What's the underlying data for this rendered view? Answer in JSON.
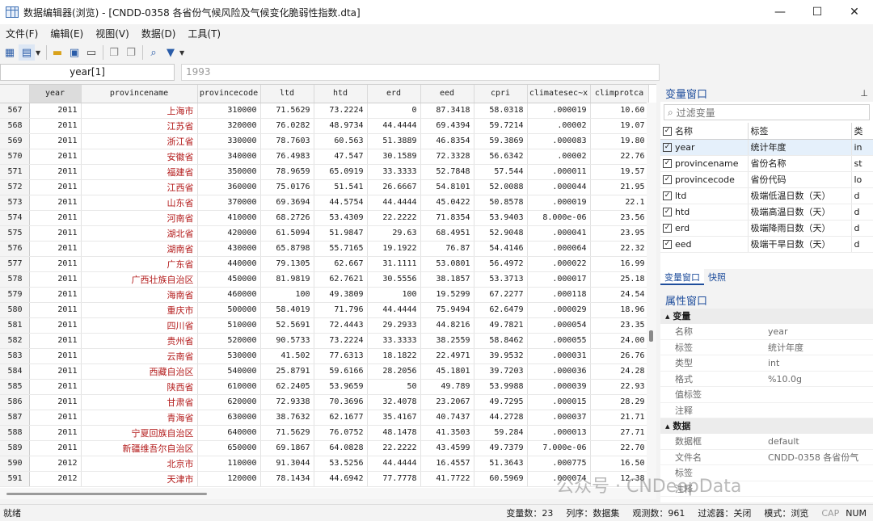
{
  "window": {
    "title": "数据编辑器(浏览) - [CNDD-0358 各省份气候风险及气候变化脆弱性指数.dta]",
    "controls": [
      "—",
      "☐",
      "✕"
    ]
  },
  "menu": [
    "文件(F)",
    "编辑(E)",
    "视图(V)",
    "数据(D)",
    "工具(T)"
  ],
  "cmd": {
    "varname": "year[1]",
    "value": "1993"
  },
  "columns": [
    "year",
    "provincename",
    "provincecode",
    "ltd",
    "htd",
    "erd",
    "eed",
    "cpri",
    "climatesec~x",
    "climprotca"
  ],
  "rows": [
    [
      "567",
      "2011",
      "上海市",
      "310000",
      "71.5629",
      "73.2224",
      "0",
      "87.3418",
      "58.0318",
      ".000019",
      "10.60"
    ],
    [
      "568",
      "2011",
      "江苏省",
      "320000",
      "76.0282",
      "48.9734",
      "44.4444",
      "69.4394",
      "59.7214",
      ".00002",
      "19.07"
    ],
    [
      "569",
      "2011",
      "浙江省",
      "330000",
      "78.7603",
      "60.563",
      "51.3889",
      "46.8354",
      "59.3869",
      ".000083",
      "19.80"
    ],
    [
      "570",
      "2011",
      "安徽省",
      "340000",
      "76.4983",
      "47.547",
      "30.1589",
      "72.3328",
      "56.6342",
      ".00002",
      "22.76"
    ],
    [
      "571",
      "2011",
      "福建省",
      "350000",
      "78.9659",
      "65.0919",
      "33.3333",
      "52.7848",
      "57.544",
      ".000011",
      "19.57"
    ],
    [
      "572",
      "2011",
      "江西省",
      "360000",
      "75.0176",
      "51.541",
      "26.6667",
      "54.8101",
      "52.0088",
      ".000044",
      "21.95"
    ],
    [
      "573",
      "2011",
      "山东省",
      "370000",
      "69.3694",
      "44.5754",
      "44.4444",
      "45.0422",
      "50.8578",
      ".000019",
      "22.1"
    ],
    [
      "574",
      "2011",
      "河南省",
      "410000",
      "68.2726",
      "53.4309",
      "22.2222",
      "71.8354",
      "53.9403",
      "8.000e-06",
      "23.56"
    ],
    [
      "575",
      "2011",
      "湖北省",
      "420000",
      "61.5094",
      "51.9847",
      "29.63",
      "68.4951",
      "52.9048",
      ".000041",
      "23.95"
    ],
    [
      "576",
      "2011",
      "湖南省",
      "430000",
      "65.8798",
      "55.7165",
      "19.1922",
      "76.87",
      "54.4146",
      ".000064",
      "22.32"
    ],
    [
      "577",
      "2011",
      "广东省",
      "440000",
      "79.1305",
      "62.667",
      "31.1111",
      "53.0801",
      "56.4972",
      ".000022",
      "16.99"
    ],
    [
      "578",
      "2011",
      "广西壮族自治区",
      "450000",
      "81.9819",
      "62.7621",
      "30.5556",
      "38.1857",
      "53.3713",
      ".000017",
      "25.18"
    ],
    [
      "579",
      "2011",
      "海南省",
      "460000",
      "100",
      "49.3809",
      "100",
      "19.5299",
      "67.2277",
      ".000118",
      "24.54"
    ],
    [
      "580",
      "2011",
      "重庆市",
      "500000",
      "58.4019",
      "71.796",
      "44.4444",
      "75.9494",
      "62.6479",
      ".000029",
      "18.96"
    ],
    [
      "581",
      "2011",
      "四川省",
      "510000",
      "52.5691",
      "72.4443",
      "29.2933",
      "44.8216",
      "49.7821",
      ".000054",
      "23.35"
    ],
    [
      "582",
      "2011",
      "贵州省",
      "520000",
      "90.5733",
      "73.2224",
      "33.3333",
      "38.2559",
      "58.8462",
      ".000055",
      "24.00"
    ],
    [
      "583",
      "2011",
      "云南省",
      "530000",
      "41.502",
      "77.6313",
      "18.1822",
      "22.4971",
      "39.9532",
      ".000031",
      "26.76"
    ],
    [
      "584",
      "2011",
      "西藏自治区",
      "540000",
      "25.8791",
      "59.6166",
      "28.2056",
      "45.1801",
      "39.7203",
      ".000036",
      "24.28"
    ],
    [
      "585",
      "2011",
      "陕西省",
      "610000",
      "62.2405",
      "53.9659",
      "50",
      "49.789",
      "53.9988",
      ".000039",
      "22.93"
    ],
    [
      "586",
      "2011",
      "甘肃省",
      "620000",
      "72.9338",
      "70.3696",
      "32.4078",
      "23.2067",
      "49.7295",
      ".000015",
      "28.29"
    ],
    [
      "587",
      "2011",
      "青海省",
      "630000",
      "38.7632",
      "62.1677",
      "35.4167",
      "40.7437",
      "44.2728",
      ".000037",
      "21.71"
    ],
    [
      "588",
      "2011",
      "宁夏回族自治区",
      "640000",
      "71.5629",
      "76.0752",
      "48.1478",
      "41.3503",
      "59.284",
      ".000013",
      "27.71"
    ],
    [
      "589",
      "2011",
      "新疆维吾尔自治区",
      "650000",
      "69.1867",
      "64.0828",
      "22.2222",
      "43.4599",
      "49.7379",
      "7.000e-06",
      "22.70"
    ],
    [
      "590",
      "2012",
      "北京市",
      "110000",
      "91.3044",
      "53.5256",
      "44.4444",
      "16.4557",
      "51.3643",
      ".000775",
      "16.50"
    ],
    [
      "591",
      "2012",
      "天津市",
      "120000",
      "78.1434",
      "44.6942",
      "77.7778",
      "41.7722",
      "60.5969",
      ".000074",
      "12.38"
    ]
  ],
  "var_panel": {
    "title": "变量窗口",
    "filter_placeholder": "过滤变量",
    "col_name": "名称",
    "col_label": "标签",
    "col_type": "类",
    "vars": [
      {
        "name": "year",
        "label": "统计年度",
        "type": "in"
      },
      {
        "name": "provincename",
        "label": "省份名称",
        "type": "st"
      },
      {
        "name": "provincecode",
        "label": "省份代码",
        "type": "lo"
      },
      {
        "name": "ltd",
        "label": "极端低温日数（天）",
        "type": "d"
      },
      {
        "name": "htd",
        "label": "极端高温日数（天）",
        "type": "d"
      },
      {
        "name": "erd",
        "label": "极端降雨日数（天）",
        "type": "d"
      },
      {
        "name": "eed",
        "label": "极端干旱日数（天）",
        "type": "d"
      }
    ]
  },
  "tabs": [
    "变量窗口",
    "快照"
  ],
  "prop_panel": {
    "title": "属性窗口",
    "sec_var": "变量",
    "var_rows": [
      {
        "k": "名称",
        "v": "year"
      },
      {
        "k": "标签",
        "v": "统计年度"
      },
      {
        "k": "类型",
        "v": "int"
      },
      {
        "k": "格式",
        "v": "%10.0g"
      },
      {
        "k": "值标签",
        "v": ""
      },
      {
        "k": "注释",
        "v": ""
      }
    ],
    "sec_data": "数据",
    "data_rows": [
      {
        "k": "数据框",
        "v": "default"
      },
      {
        "k": "文件名",
        "v": "CNDD-0358 各省份气"
      },
      {
        "k": "标签",
        "v": ""
      },
      {
        "k": "注释",
        "v": ""
      }
    ]
  },
  "status": {
    "ready": "就绪",
    "vars": "变量数：23",
    "order": "列序：数据集",
    "obs": "观测数：961",
    "filter": "过滤器：关闭",
    "mode": "模式：浏览",
    "cap": "CAP",
    "num": "NUM"
  },
  "watermark": "公众号 · CNDeepData"
}
